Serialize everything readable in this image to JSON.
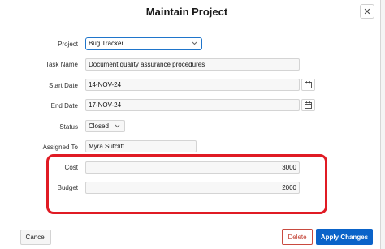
{
  "dialog": {
    "title": "Maintain Project",
    "close_icon": "close-icon"
  },
  "form": {
    "project": {
      "label": "Project",
      "value": "Bug Tracker",
      "icon": "chevron-down-icon"
    },
    "task_name": {
      "label": "Task Name",
      "value": "Document quality assurance procedures"
    },
    "start_date": {
      "label": "Start Date",
      "value": "14-NOV-24",
      "icon": "calendar-icon"
    },
    "end_date": {
      "label": "End Date",
      "value": "17-NOV-24",
      "icon": "calendar-icon"
    },
    "status": {
      "label": "Status",
      "value": "Closed",
      "icon": "chevron-down-icon"
    },
    "assigned_to": {
      "label": "Assigned To",
      "value": "Myra Sutcliff"
    },
    "cost": {
      "label": "Cost",
      "value": "3000"
    },
    "budget": {
      "label": "Budget",
      "value": "2000"
    }
  },
  "highlight_color": "#e01b24",
  "buttons": {
    "cancel": "Cancel",
    "delete": "Delete",
    "apply": "Apply Changes"
  },
  "colors": {
    "primary": "#0a63c9",
    "danger": "#c0392b",
    "focus": "#1f75cb"
  }
}
